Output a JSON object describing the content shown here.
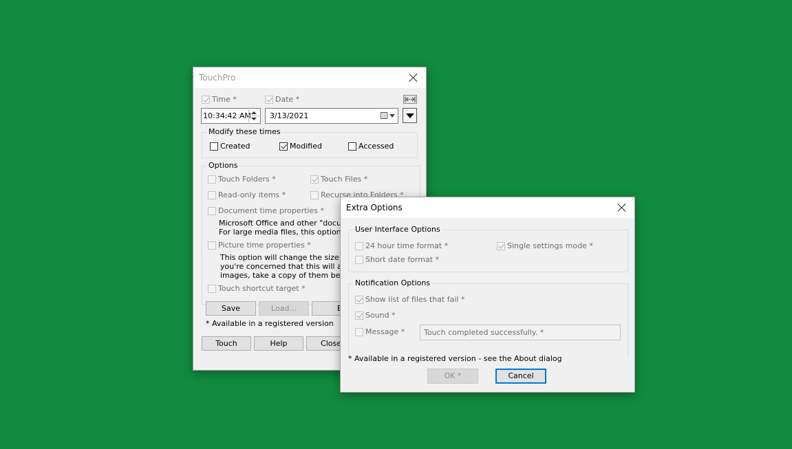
{
  "touchpro": {
    "title": "TouchPro",
    "time_label": "Time *",
    "date_label": "Date *",
    "time_value": "10:34:42 AM",
    "date_value": "3/13/2021",
    "modify_group": "Modify these times",
    "created_label": "Created",
    "modified_label": "Modified",
    "accessed_label": "Accessed",
    "options_group": "Options",
    "touch_folders": "Touch Folders *",
    "touch_files": "Touch Files *",
    "readonly_items": "Read-only items *",
    "recurse_folders": "Recurse into Folders *",
    "doc_time_props": "Document time properties *",
    "doc_desc_1": "Microsoft Office and other \"documen",
    "doc_desc_2": "For large media files, this option may",
    "pic_time_props": "Picture time properties *",
    "pic_desc_1": "This option will change the size of yo",
    "pic_desc_2": "you're concerned that this will affect",
    "pic_desc_3": "images, take a copy of them before u",
    "shortcut_target": "Touch shortcut target *",
    "save_label": "Save",
    "load_label": "Load...",
    "partial_button": "E",
    "registered_note": "* Available in a registered version",
    "touch_button": "Touch",
    "help_button": "Help",
    "close_button": "Close"
  },
  "extra": {
    "title": "Extra Options",
    "ui_group": "User Interface Options",
    "hour24": "24 hour time format *",
    "single_settings": "Single settings mode *",
    "short_date": "Short date format *",
    "notif_group": "Notification Options",
    "show_list": "Show list of files that fail *",
    "sound": "Sound *",
    "message": "Message *",
    "message_value": "Touch completed successfully. *",
    "registered_note": "* Available in a registered version - see the About dialog",
    "ok_label": "OK *",
    "cancel_label": "Cancel"
  },
  "colors": {
    "desktop": "#118c3f",
    "dialog_bg": "#f0f0f0",
    "accent": "#0078d7"
  }
}
